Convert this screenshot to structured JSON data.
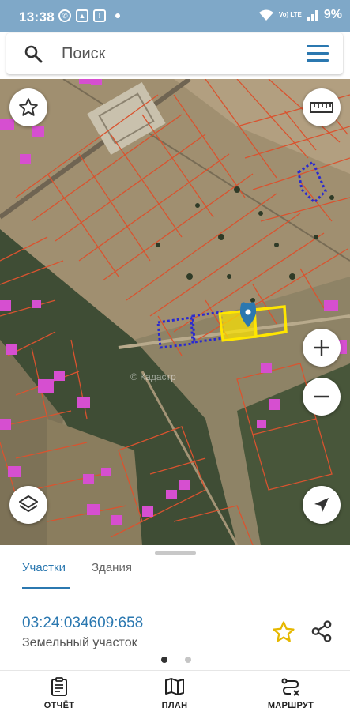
{
  "status_bar": {
    "time": "13:38",
    "network": "Vo) LTE",
    "battery": "9%"
  },
  "search": {
    "placeholder": "Поиск",
    "icons": [
      "search-icon",
      "menu-icon"
    ]
  },
  "map": {
    "watermark": "© Кадастр",
    "controls": [
      "star-icon",
      "ruler-icon",
      "zoom-in-icon",
      "zoom-out-icon",
      "layers-icon",
      "location-arrow-icon"
    ],
    "selected_parcel_color": "#ffe600",
    "parcel_line_color": "#d9532f",
    "dashed_parcel_color": "#2a2ad0",
    "building_color": "#d64fd0"
  },
  "sheet": {
    "tabs": [
      {
        "label": "Участки",
        "active": true
      },
      {
        "label": "Здания",
        "active": false
      }
    ],
    "parcel_id": "03:24:034609:658",
    "parcel_type": "Земельный участок",
    "page_indicator": {
      "current": 1,
      "total": 2
    }
  },
  "bottom_nav": [
    {
      "label": "ОТЧЁТ",
      "icon": "report-icon"
    },
    {
      "label": "ПЛАН",
      "icon": "map-icon"
    },
    {
      "label": "МАРШРУТ",
      "icon": "route-icon"
    }
  ],
  "colors": {
    "accent": "#2b78b0",
    "status_bar": "#7fa8c8"
  }
}
